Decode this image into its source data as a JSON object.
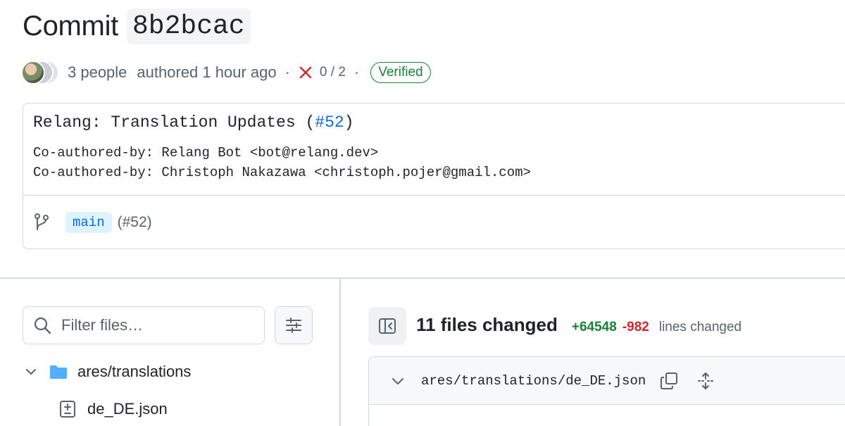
{
  "header": {
    "title_word": "Commit",
    "sha": "8b2bcac"
  },
  "meta": {
    "people": "3 people",
    "authored": "authored 1 hour ago",
    "dot": "·",
    "checks": "0 / 2",
    "verified": "Verified"
  },
  "commit": {
    "title_prefix": "Relang: Translation Updates (",
    "title_link": "#52",
    "title_suffix": ")",
    "body_lines": [
      "Co-authored-by: Relang Bot <bot@relang.dev>",
      "Co-authored-by: Christoph Nakazawa <christoph.pojer@gmail.com>"
    ],
    "branch": "main",
    "branch_pr": "(#52)"
  },
  "file_tree": {
    "filter_placeholder": "Filter files…",
    "folder": "ares/translations",
    "file": "de_DE.json"
  },
  "summary": {
    "files_changed": "11 files changed",
    "additions": "+64548",
    "deletions": "-982",
    "lines_label": "lines changed"
  },
  "file_card": {
    "path": "ares/translations/de_DE.json"
  },
  "colors": {
    "link": "#0969da",
    "success": "#1a7f37",
    "danger": "#d1242f",
    "border": "#d1d9e0"
  },
  "icons": [
    "fail-x-icon",
    "git-branch-icon",
    "search-icon",
    "filter-settings-icon",
    "chevron-down-icon",
    "folder-icon",
    "file-diff-icon",
    "sidebar-collapse-icon",
    "copy-icon",
    "expand-icon"
  ]
}
